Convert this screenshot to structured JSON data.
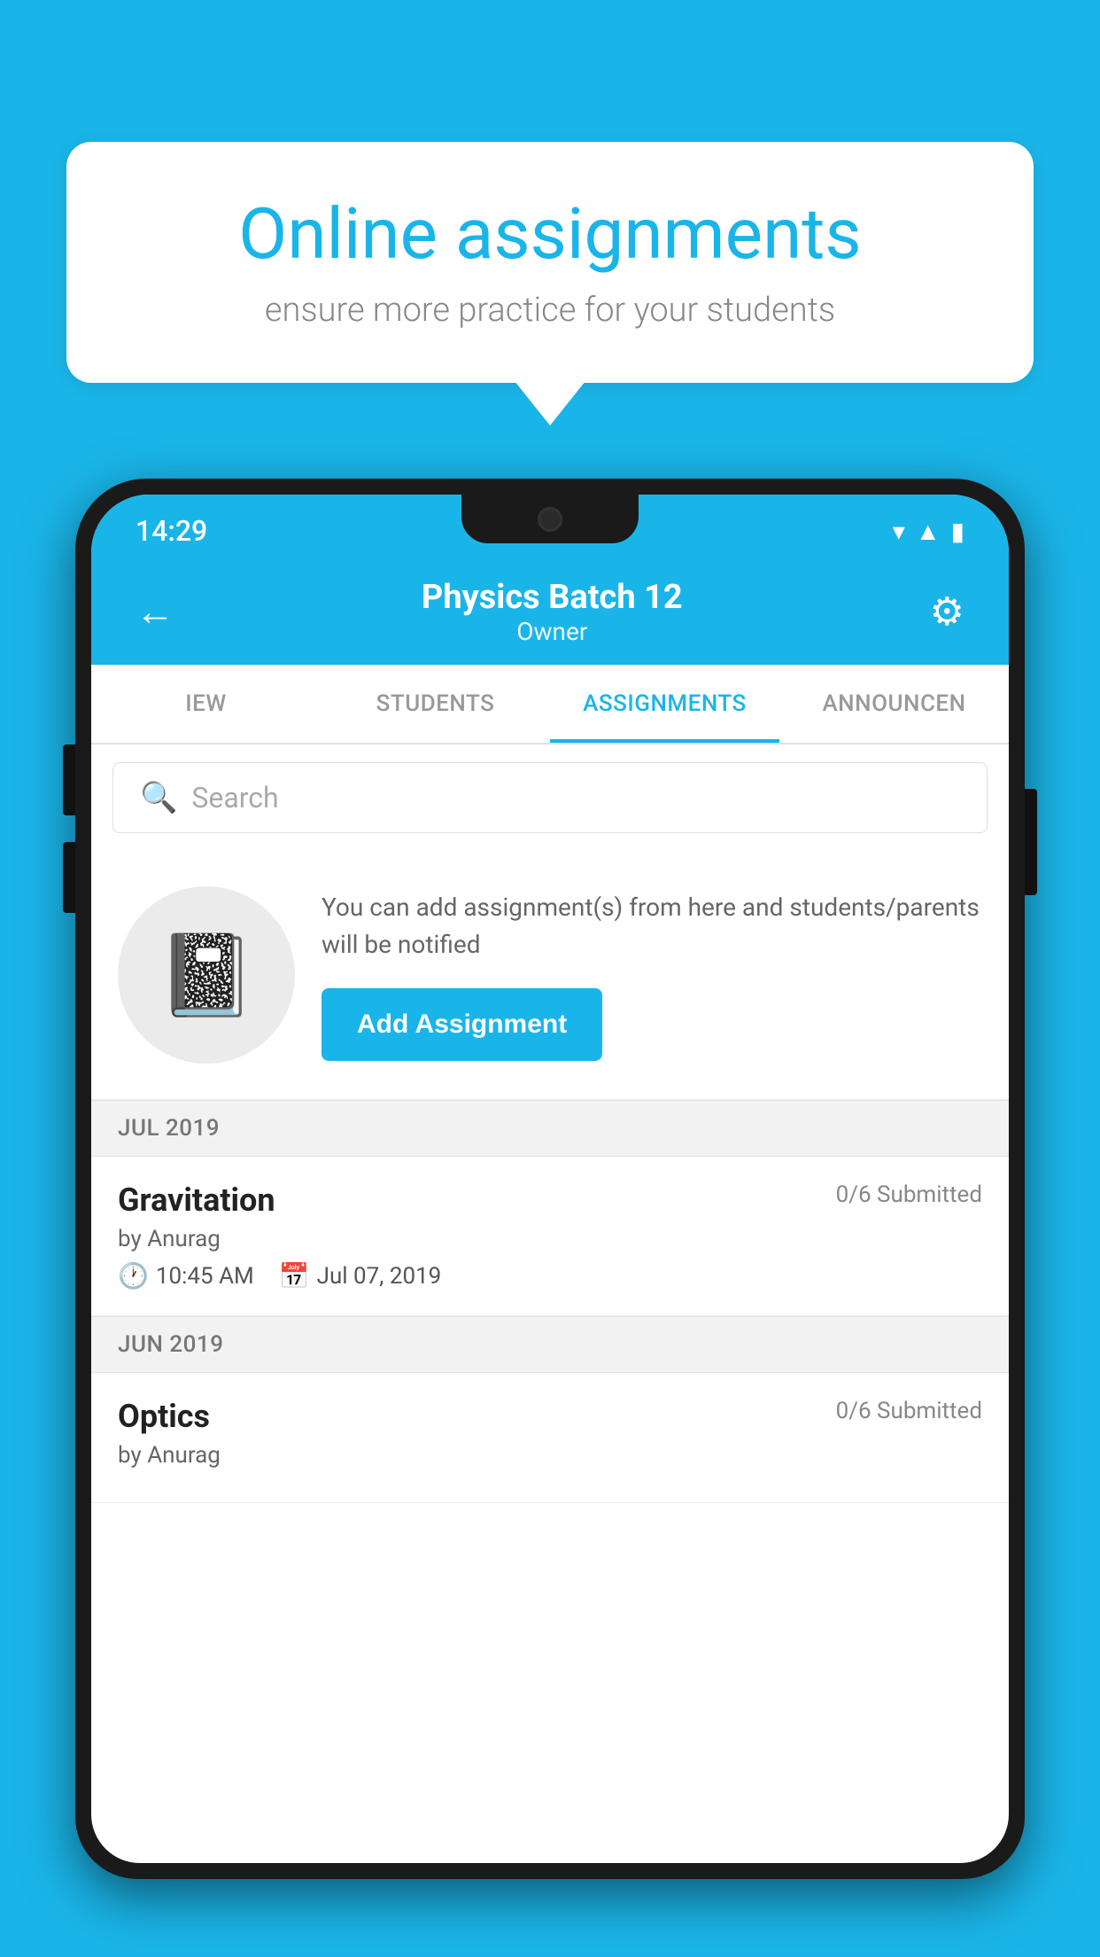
{
  "background_color": "#1ab5e8",
  "speech_bubble": {
    "title": "Online assignments",
    "subtitle": "ensure more practice for your students"
  },
  "status_bar": {
    "time": "14:29",
    "wifi": "▼",
    "signal": "▲",
    "battery": "▮"
  },
  "app_bar": {
    "title": "Physics Batch 12",
    "subtitle": "Owner",
    "back_label": "←",
    "settings_label": "⚙"
  },
  "tabs": [
    {
      "label": "IEW",
      "active": false
    },
    {
      "label": "STUDENTS",
      "active": false
    },
    {
      "label": "ASSIGNMENTS",
      "active": true
    },
    {
      "label": "ANNOUNCEN",
      "active": false
    }
  ],
  "search": {
    "placeholder": "Search"
  },
  "add_section": {
    "description": "You can add assignment(s) from here and students/parents will be notified",
    "button_label": "Add Assignment"
  },
  "sections": [
    {
      "header": "JUL 2019",
      "assignments": [
        {
          "name": "Gravitation",
          "submitted": "0/6 Submitted",
          "by": "by Anurag",
          "time": "10:45 AM",
          "date": "Jul 07, 2019"
        }
      ]
    },
    {
      "header": "JUN 2019",
      "assignments": [
        {
          "name": "Optics",
          "submitted": "0/6 Submitted",
          "by": "by Anurag",
          "time": "",
          "date": ""
        }
      ]
    }
  ]
}
